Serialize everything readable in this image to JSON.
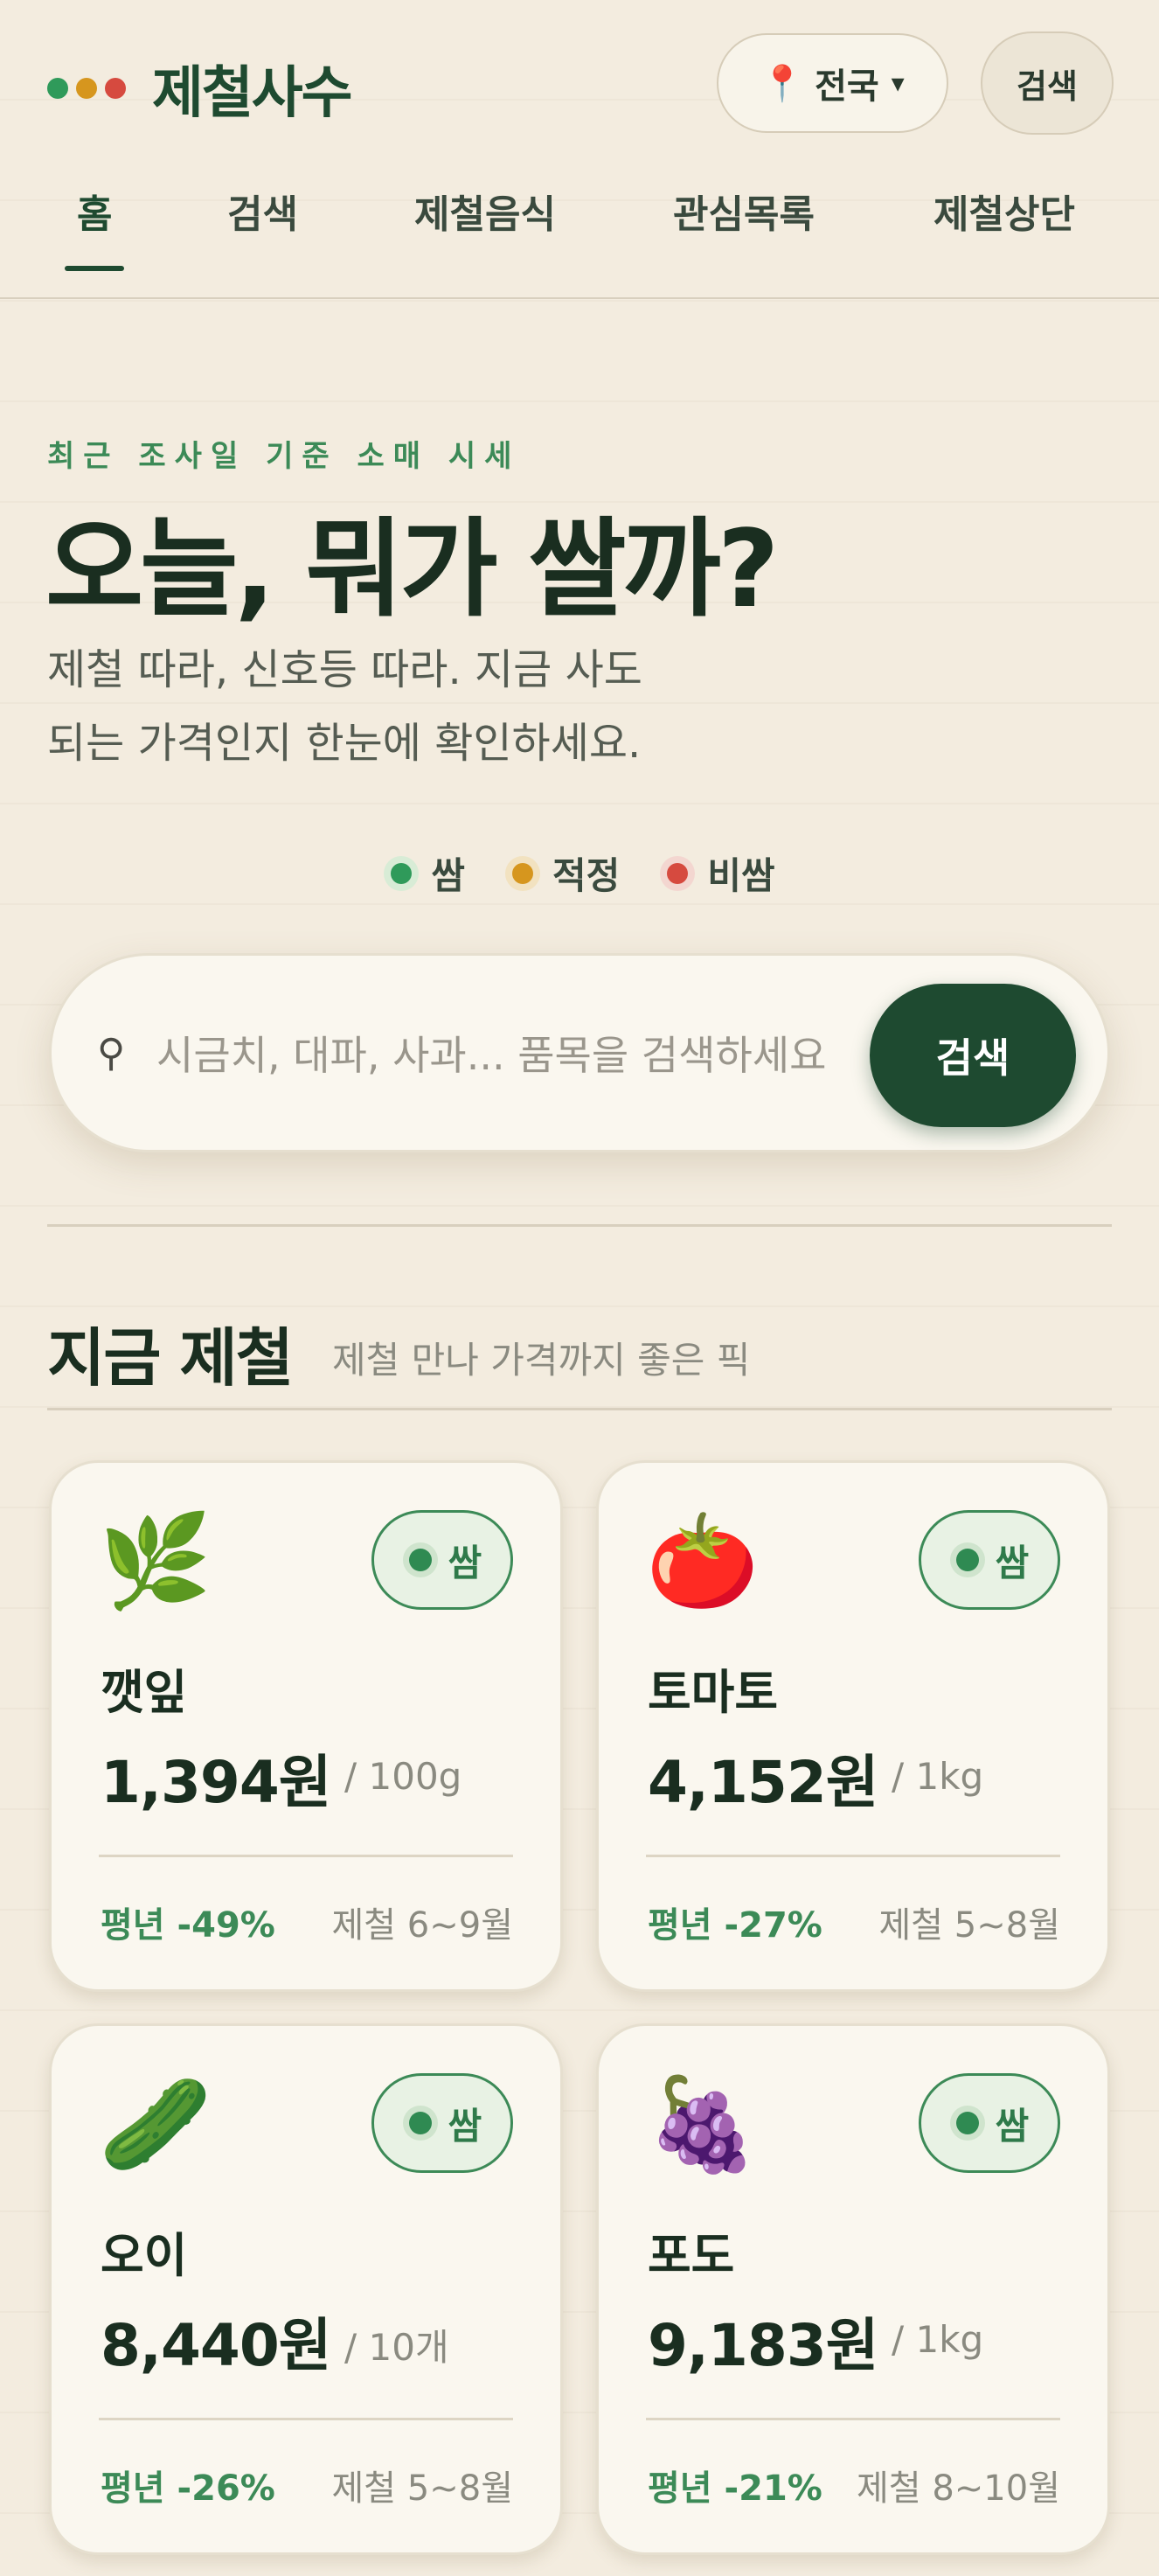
{
  "header": {
    "brand": "제철사수",
    "dots": [
      "#2f9a5a",
      "#d6961e",
      "#d64a3f"
    ],
    "region": {
      "label": "전국",
      "icon": "pin-icon",
      "caret": "▾"
    },
    "search_button": "검색"
  },
  "tabs": [
    {
      "label": "홈",
      "active": true
    },
    {
      "label": "검색",
      "active": false
    },
    {
      "label": "제철음식",
      "active": false
    },
    {
      "label": "관심목록",
      "active": false
    },
    {
      "label": "제철상단",
      "active": false
    }
  ],
  "hero": {
    "eyebrow": "최근 조사일 기준 소매 시세",
    "headline": "오늘, 뭐가 쌀까?",
    "sub_line1": "제철 따라, 신호등 따라. 지금 사도",
    "sub_line2": "되는 가격인지 한눈에 확인하세요."
  },
  "legend": [
    {
      "label": "쌈",
      "color": "#2f9a5a",
      "ring": "#d8ecd6"
    },
    {
      "label": "적정",
      "color": "#d6961e",
      "ring": "#f2e2c0"
    },
    {
      "label": "비쌈",
      "color": "#d64a3f",
      "ring": "#f3d6d0"
    }
  ],
  "search": {
    "placeholder": "시금치, 대파, 사과... 품목을 검색하세요",
    "value": "",
    "button": "검색",
    "icon": "search-icon"
  },
  "section": {
    "title": "지금 제철",
    "subtitle": "제철 만나 가격까지 좋은 픽"
  },
  "cards": [
    {
      "emoji": "🌿",
      "icon": "herb-icon",
      "badge": "쌈",
      "name": "깻잎",
      "price": "1,394원",
      "unit": "/ 100g",
      "diff": "평년 -49%",
      "season": "제철 6~9월"
    },
    {
      "emoji": "🍅",
      "icon": "tomato-icon",
      "badge": "쌈",
      "name": "토마토",
      "price": "4,152원",
      "unit": "/ 1kg",
      "diff": "평년 -27%",
      "season": "제철 5~8월"
    },
    {
      "emoji": "🥒",
      "icon": "cucumber-icon",
      "badge": "쌈",
      "name": "오이",
      "price": "8,440원",
      "unit": "/ 10개",
      "diff": "평년 -26%",
      "season": "제철 5~8월"
    },
    {
      "emoji": "🍇",
      "icon": "grapes-icon",
      "badge": "쌈",
      "name": "포도",
      "price": "9,183원",
      "unit": "/ 1kg",
      "diff": "평년 -21%",
      "season": "제철 8~10월"
    }
  ],
  "colors": {
    "accent": "#1e4a30",
    "cheap": "#2f9a5a",
    "fair": "#d6961e",
    "expensive": "#d64a3f",
    "background": "#f3ecdf"
  }
}
